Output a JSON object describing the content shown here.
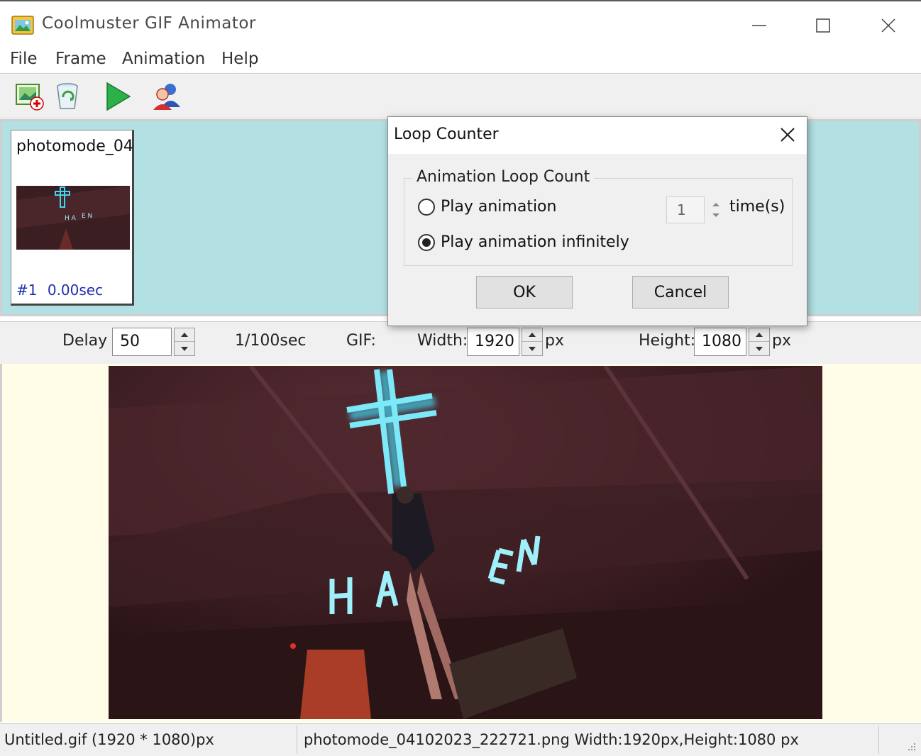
{
  "window": {
    "title": "Coolmuster GIF Animator",
    "icons": {
      "app": "app-icon",
      "minimize": "minimize-icon",
      "maximize": "maximize-icon",
      "close": "close-icon"
    }
  },
  "menu": {
    "items": [
      "File",
      "Frame",
      "Animation",
      "Help"
    ]
  },
  "toolbar": {
    "tools": [
      {
        "name": "add-image",
        "icon": "add-image-icon"
      },
      {
        "name": "delete",
        "icon": "recycle-bin-icon"
      },
      {
        "name": "play",
        "icon": "play-icon"
      },
      {
        "name": "users",
        "icon": "users-icon"
      }
    ]
  },
  "frames": [
    {
      "name": "photomode_04",
      "index": "#1",
      "delay": "0.00sec"
    }
  ],
  "properties": {
    "delay_label": "Delay :",
    "delay_value": "50",
    "delay_unit": "1/100sec",
    "gif_label": "GIF:",
    "width_label": "Width:",
    "width_value": "1920",
    "width_unit": "px",
    "height_label": "Height:",
    "height_value": "1080",
    "height_unit": "px"
  },
  "status": {
    "left": "Untitled.gif (1920 * 1080)px",
    "right": "photomode_04102023_222721.png Width:1920px,Height:1080 px"
  },
  "dialog": {
    "title": "Loop Counter",
    "group_label": "Animation Loop Count",
    "option_count_label": "Play animation",
    "option_infinite_label": "Play animation infinitely",
    "selected_option": "infinite",
    "count_value": "1",
    "times_label": "time(s)",
    "ok_label": "OK",
    "cancel_label": "Cancel"
  },
  "colors": {
    "frames_bg": "#b3e0e3",
    "preview_bg": "#fffde8",
    "neon": "#3fd6f0",
    "frame_info": "#1f2fb0"
  }
}
